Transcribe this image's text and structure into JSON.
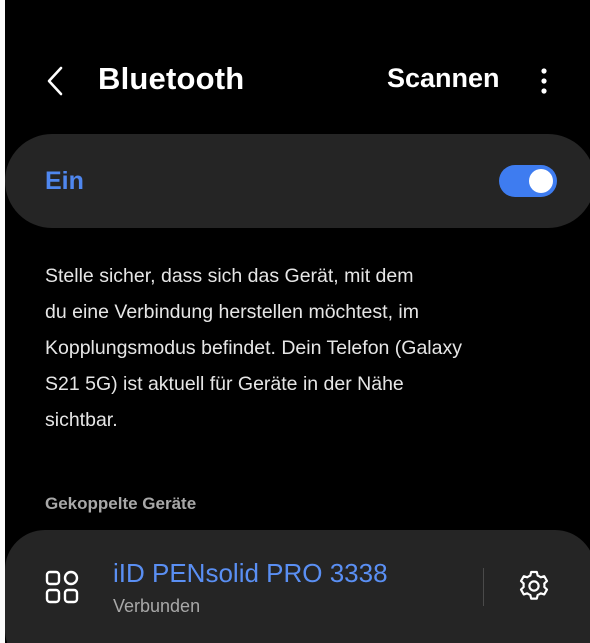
{
  "header": {
    "title": "Bluetooth",
    "scan_label": "Scannen"
  },
  "bluetooth_toggle": {
    "label": "Ein",
    "state": "on",
    "accent_color": "#4f87ef"
  },
  "info": {
    "lines": [
      "Stelle sicher, dass sich das Gerät, mit dem",
      "du eine Verbindung herstellen möchtest, im",
      "Kopplungsmodus befindet. Dein Telefon (Galaxy",
      "S21 5G) ist aktuell für Geräte in der Nähe",
      "sichtbar."
    ]
  },
  "paired_devices": {
    "header": "Gekoppelte Geräte",
    "items": [
      {
        "name": "iID PENsolid PRO 3338",
        "status": "Verbunden",
        "icon": "device-grid-icon"
      }
    ]
  }
}
